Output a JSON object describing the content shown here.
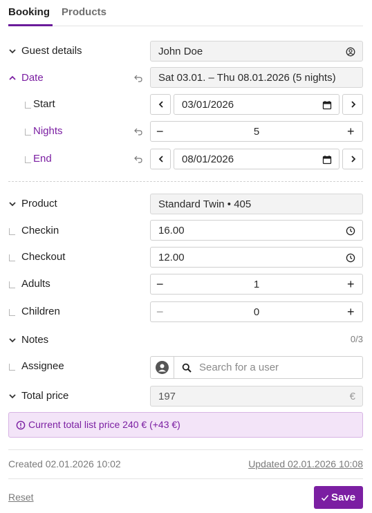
{
  "tabs": [
    {
      "label": "Booking"
    },
    {
      "label": "Products"
    }
  ],
  "guest": {
    "label": "Guest details",
    "value": "John Doe",
    "icon": "account-circle-icon"
  },
  "date": {
    "label": "Date",
    "value": "Sat 03.01. – Thu 08.01.2026 (5 nights)",
    "start": {
      "label": "Start",
      "value": "03/01/2026"
    },
    "nights": {
      "label": "Nights",
      "value": "5"
    },
    "end": {
      "label": "End",
      "value": "08/01/2026"
    }
  },
  "product": {
    "label": "Product",
    "value": "Standard Twin • 405",
    "checkin": {
      "label": "Checkin",
      "value": "16.00"
    },
    "checkout": {
      "label": "Checkout",
      "value": "12.00"
    },
    "adults": {
      "label": "Adults",
      "value": "1"
    },
    "children": {
      "label": "Children",
      "value": "0"
    }
  },
  "notes": {
    "label": "Notes",
    "count": "0/3",
    "assignee": {
      "label": "Assignee",
      "placeholder": "Search for a user"
    }
  },
  "total_price": {
    "label": "Total price",
    "value": "197",
    "currency": "€"
  },
  "alert": {
    "text": "Current total list price 240 € (+43 €)"
  },
  "meta": {
    "created": "Created 02.01.2026 10:02",
    "updated": "Updated 02.01.2026 10:08"
  },
  "footer": {
    "reset_label": "Reset",
    "save_label": "Save"
  },
  "colors": {
    "accent": "#7b1fa2",
    "alert_bg": "#f3e4f8"
  }
}
